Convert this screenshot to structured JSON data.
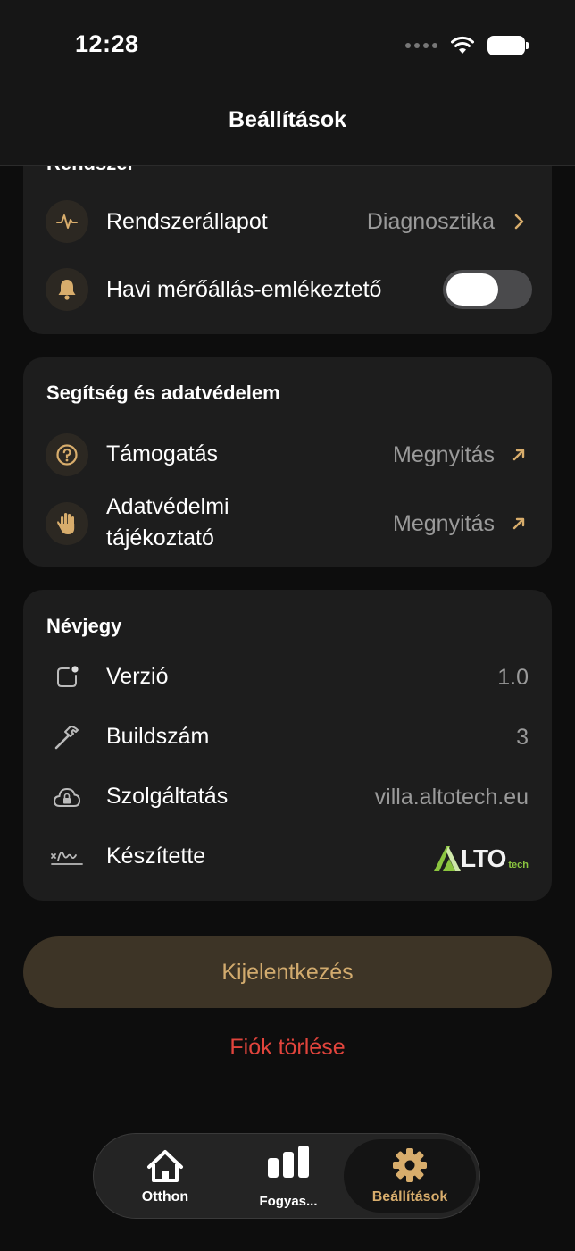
{
  "status_bar": {
    "time": "12:28"
  },
  "header": {
    "title": "Beállítások"
  },
  "system_section": {
    "title": "Rendszer",
    "rows": [
      {
        "label": "Rendszerállapot",
        "value": "Diagnosztika",
        "icon": "pulse-icon"
      },
      {
        "label": "Havi mérőállás-emlékeztető",
        "icon": "bell-icon",
        "toggle_on": false
      }
    ]
  },
  "help_section": {
    "title": "Segítség és adatvédelem",
    "rows": [
      {
        "label": "Támogatás",
        "value": "Megnyitás",
        "icon": "question-icon"
      },
      {
        "label_line1": "Adatvédelmi",
        "label_line2": "tájékoztató",
        "value": "Megnyitás",
        "icon": "hand-icon"
      }
    ]
  },
  "about_section": {
    "title": "Névjegy",
    "rows": [
      {
        "label": "Verzió",
        "value": "1.0",
        "icon": "app-badge-icon"
      },
      {
        "label": "Buildszám",
        "value": "3",
        "icon": "hammer-icon"
      },
      {
        "label": "Szolgáltatás",
        "value": "villa.altotech.eu",
        "icon": "cloud-lock-icon"
      },
      {
        "label": "Készítette",
        "icon": "signature-icon",
        "logo_text": "LTO",
        "logo_sub": "tech"
      }
    ]
  },
  "actions": {
    "logout": "Kijelentkezés",
    "delete_account": "Fiók törlése"
  },
  "tabbar": {
    "tabs": [
      {
        "label": "Otthon",
        "icon": "house-icon"
      },
      {
        "label": "Fogyas...",
        "icon": "bar-chart-icon"
      },
      {
        "label": "Beállítások",
        "icon": "gear-icon",
        "active": true
      }
    ]
  },
  "colors": {
    "accent": "#D8AD6C",
    "destructive": "#E0443C",
    "card": "#1D1D1D",
    "background": "#0D0D0D"
  }
}
